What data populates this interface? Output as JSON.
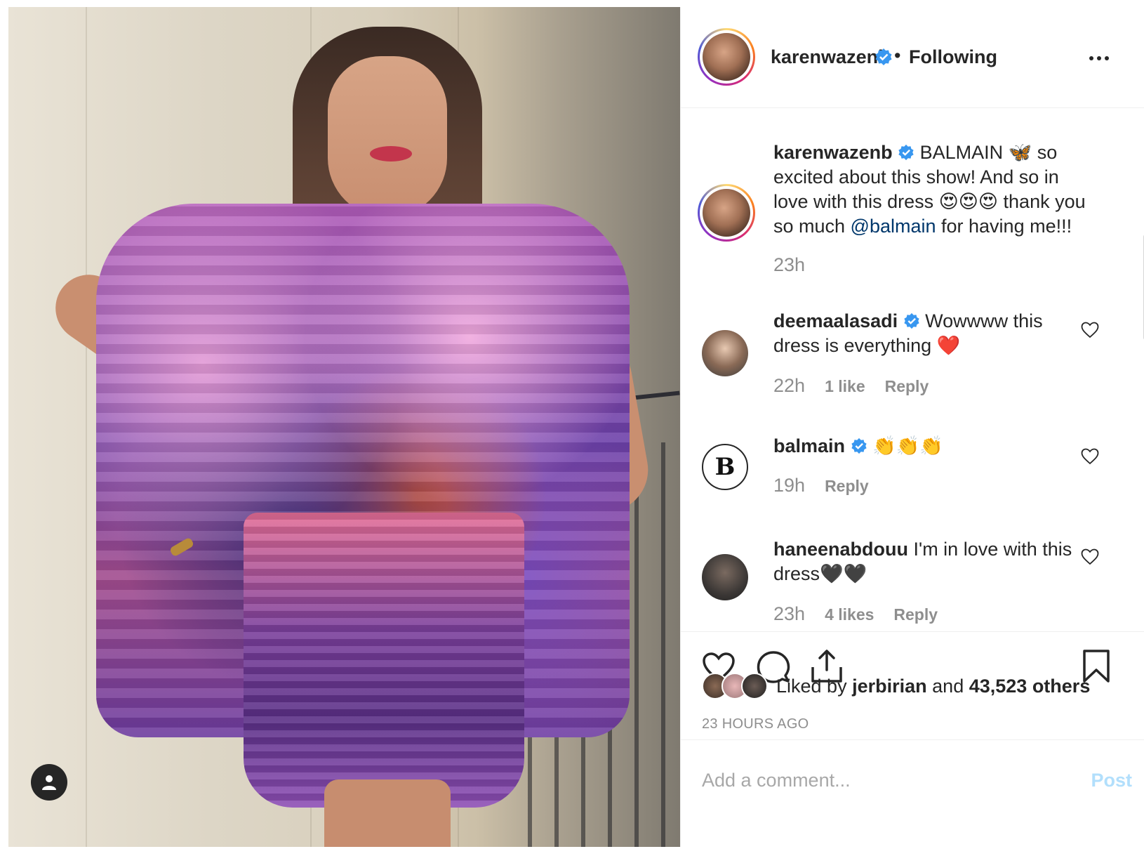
{
  "post": {
    "username": "karenwazenb",
    "follow_status": "Following",
    "separator": "•"
  },
  "caption": {
    "username": "karenwazenb",
    "text_before_mention": "BALMAIN 🦋 so excited about this show! And so in love with this dress 😍😍😍 thank you so much ",
    "mention": "@balmain",
    "text_after_mention": " for having me!!!",
    "time": "23h"
  },
  "comments": [
    {
      "username": "deemaalasadi",
      "text": "Wowwww this dress is everything ❤️",
      "time": "22h",
      "likes": "1 like",
      "reply": "Reply",
      "verified": true
    },
    {
      "username": "balmain",
      "text": "👏👏👏",
      "time": "19h",
      "reply": "Reply",
      "verified": true
    },
    {
      "username": "haneenabdouu",
      "text": "I'm in love with this dress🖤🖤",
      "time": "23h",
      "likes": "4 likes",
      "reply": "Reply",
      "verified": false
    }
  ],
  "likes": {
    "prefix": "Liked by",
    "first_user": "jerbirian",
    "and": "and",
    "others": "43,523 others"
  },
  "timestamp": "23 HOURS AGO",
  "add_comment": {
    "placeholder": "Add a comment...",
    "post_label": "Post"
  },
  "icons": {
    "like": "heart-icon",
    "comment": "comment-icon",
    "share": "share-icon",
    "save": "bookmark-icon",
    "more": "more-options-icon",
    "verified": "verified-badge-icon",
    "user": "user-icon"
  },
  "colors": {
    "verified": "#3897f0",
    "link": "#00376b",
    "muted": "#8e8e8e",
    "post_disabled": "#b2dffc"
  }
}
